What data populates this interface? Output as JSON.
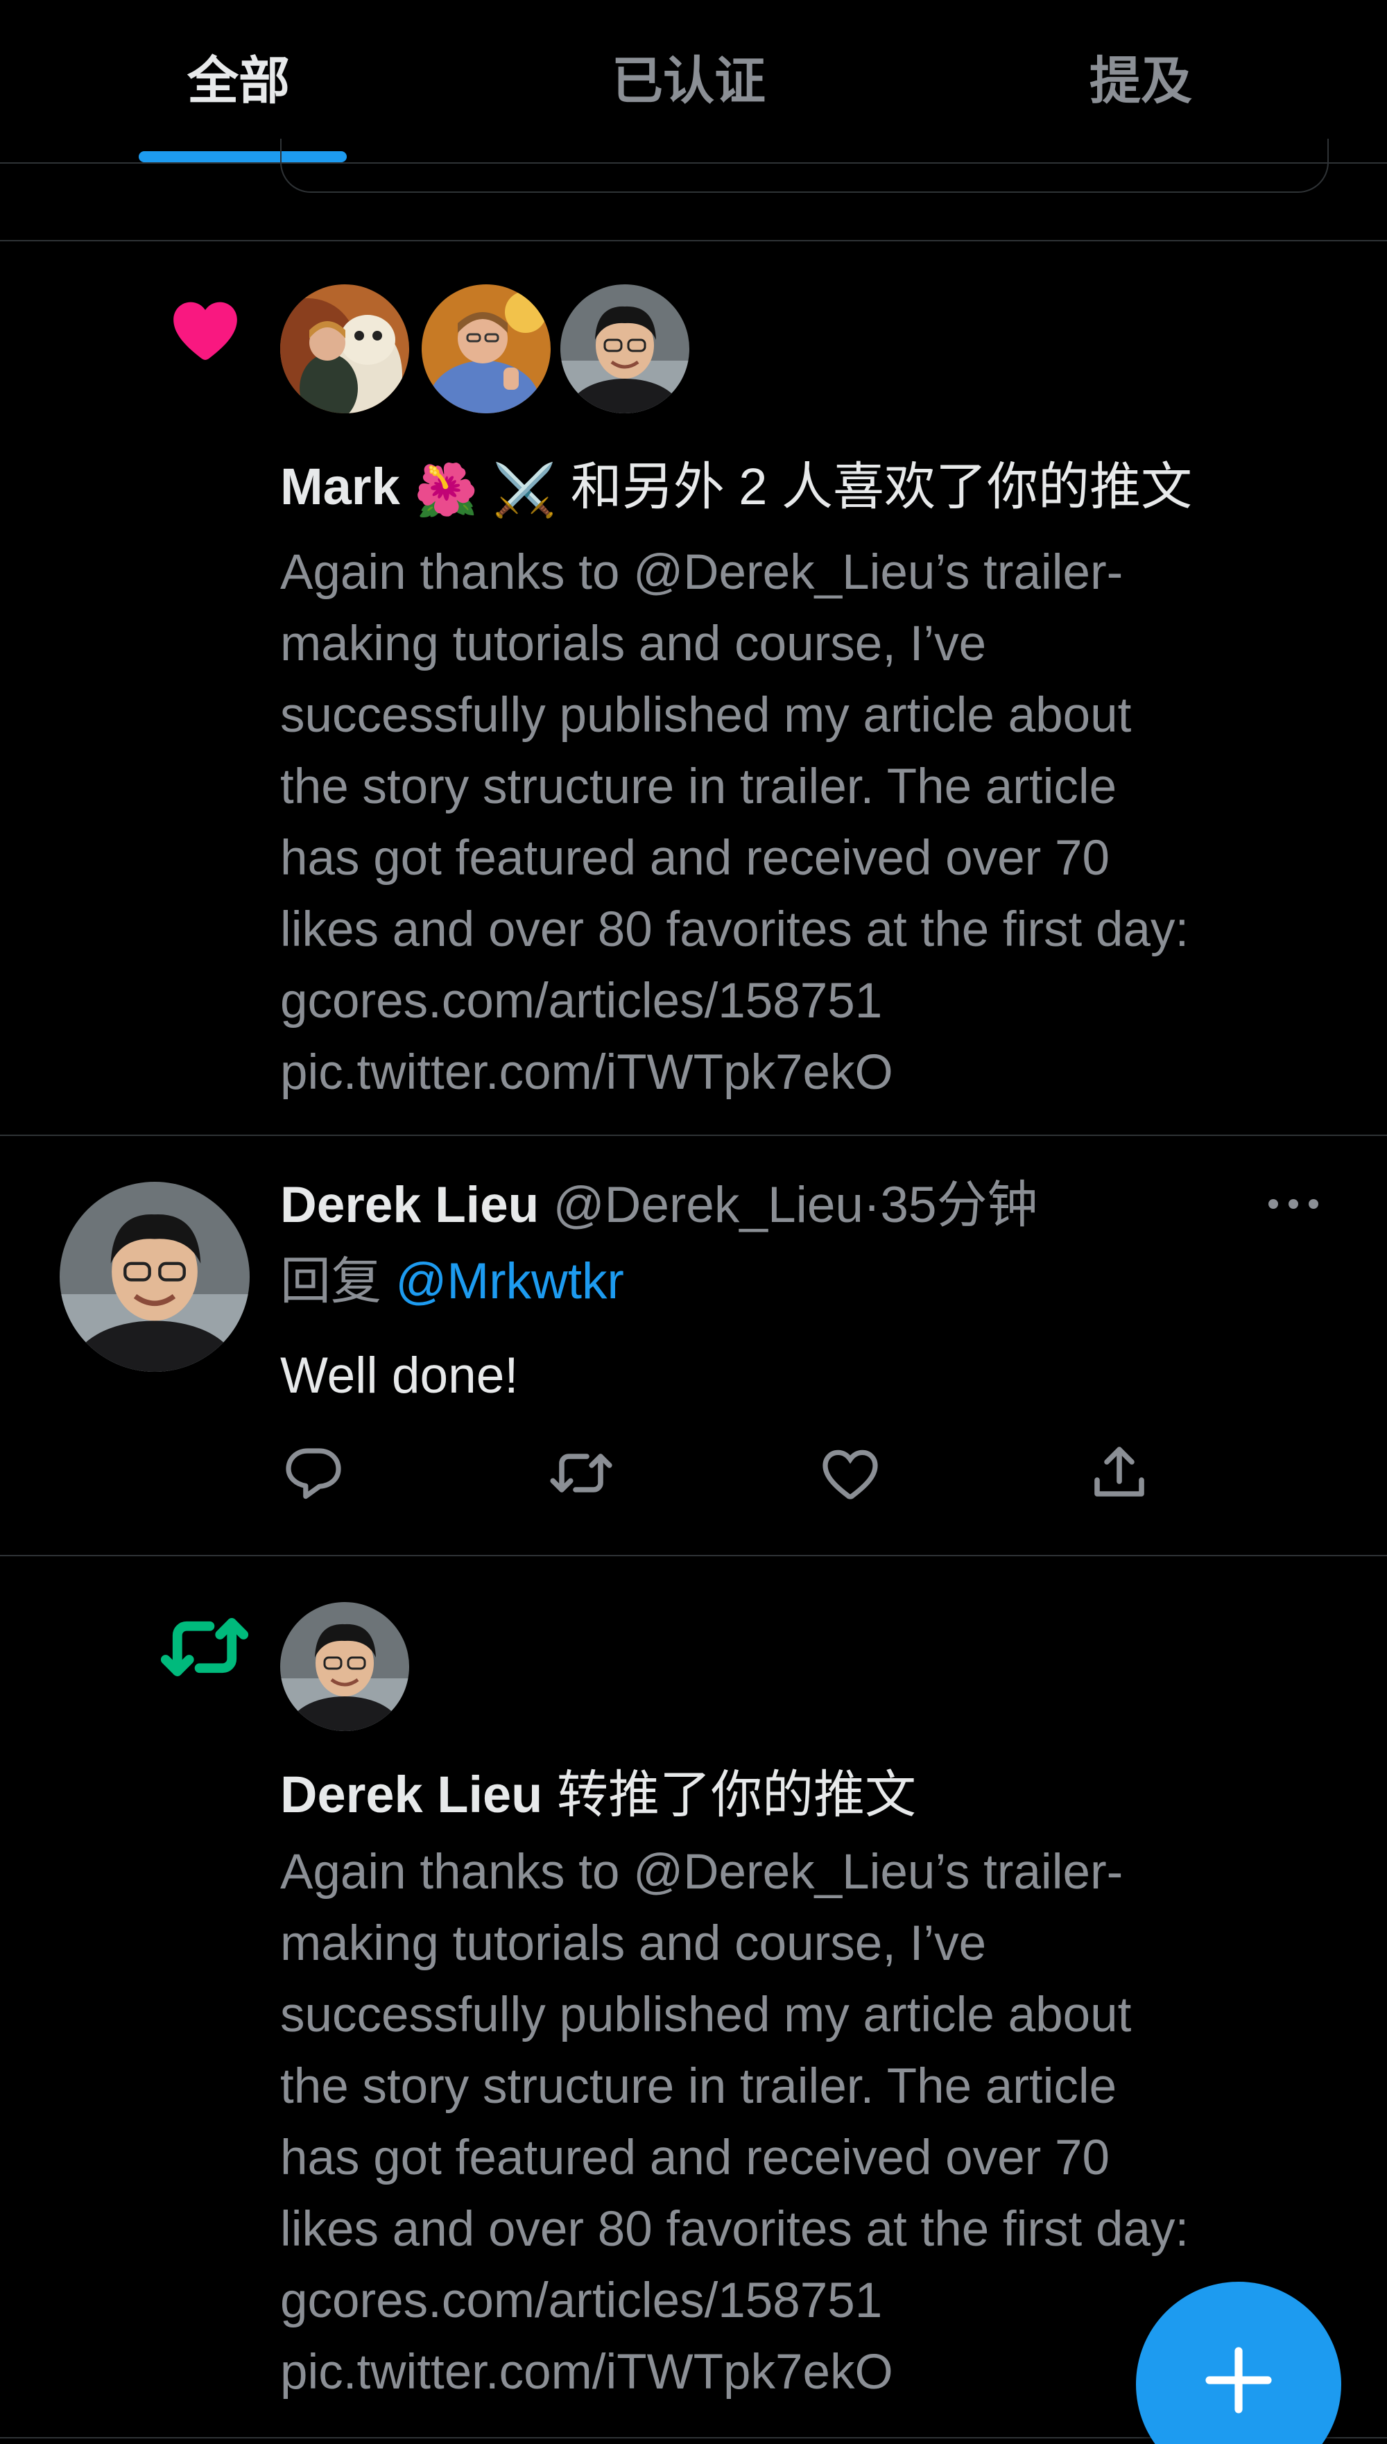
{
  "tabs": [
    {
      "label": "全部",
      "active": true
    },
    {
      "label": "已认证",
      "active": false
    },
    {
      "label": "提及",
      "active": false
    }
  ],
  "like_notification": {
    "icon": "heart-icon",
    "icon_color": "#f91880",
    "actor": "Mark",
    "actor_emojis": "🌺 ⚔️",
    "action": "和另外 2 人喜欢了你的推文",
    "tweet_lines": [
      "Again thanks to @Derek_Lieu’s trailer-",
      "making tutorials and course, I’ve",
      "successfully published my article about",
      "the story structure in trailer. The article",
      "has got featured and received over 70",
      "likes and over 80 favorites at the first day:",
      "gcores.com/articles/158751",
      "pic.twitter.com/iTWTpk7ekO"
    ]
  },
  "reply_tweet": {
    "name": "Derek Lieu",
    "handle": "@Derek_Lieu",
    "separator": "·",
    "time": "35分钟",
    "reply_prefix": "回复",
    "reply_to": "@Mrkwtkr",
    "text": "Well done!",
    "actions": [
      "reply-icon",
      "retweet-icon",
      "like-icon",
      "share-icon"
    ]
  },
  "retweet_notification": {
    "icon": "retweet-icon",
    "icon_color": "#00ba7c",
    "actor": "Derek Lieu",
    "action": "转推了你的推文",
    "tweet_lines": [
      "Again thanks to @Derek_Lieu’s trailer-",
      "making tutorials and course, I’ve",
      "successfully published my article about",
      "the story structure in trailer. The article",
      "has got featured and received over 70",
      "likes and over 80 favorites at the first day:",
      "gcores.com/articles/158751",
      "pic.twitter.com/iTWTpk7ekO"
    ]
  },
  "fab": {
    "icon": "compose-plus-icon",
    "color": "#1d9bf0"
  },
  "colors": {
    "background": "#000000",
    "text_primary": "#e7e9ea",
    "text_secondary": "#8b8f95",
    "accent": "#1d9bf0",
    "divider": "#2f3336"
  }
}
